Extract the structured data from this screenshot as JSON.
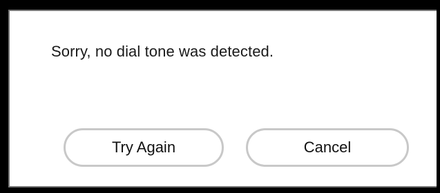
{
  "dialog": {
    "message": "Sorry, no dial tone was detected.",
    "buttons": {
      "try_again": "Try Again",
      "cancel": "Cancel"
    }
  },
  "colors": {
    "frame": "#000000",
    "dialog_background": "#ffffff",
    "button_border": "#c8c8c8",
    "text": "#1a1a1a"
  }
}
